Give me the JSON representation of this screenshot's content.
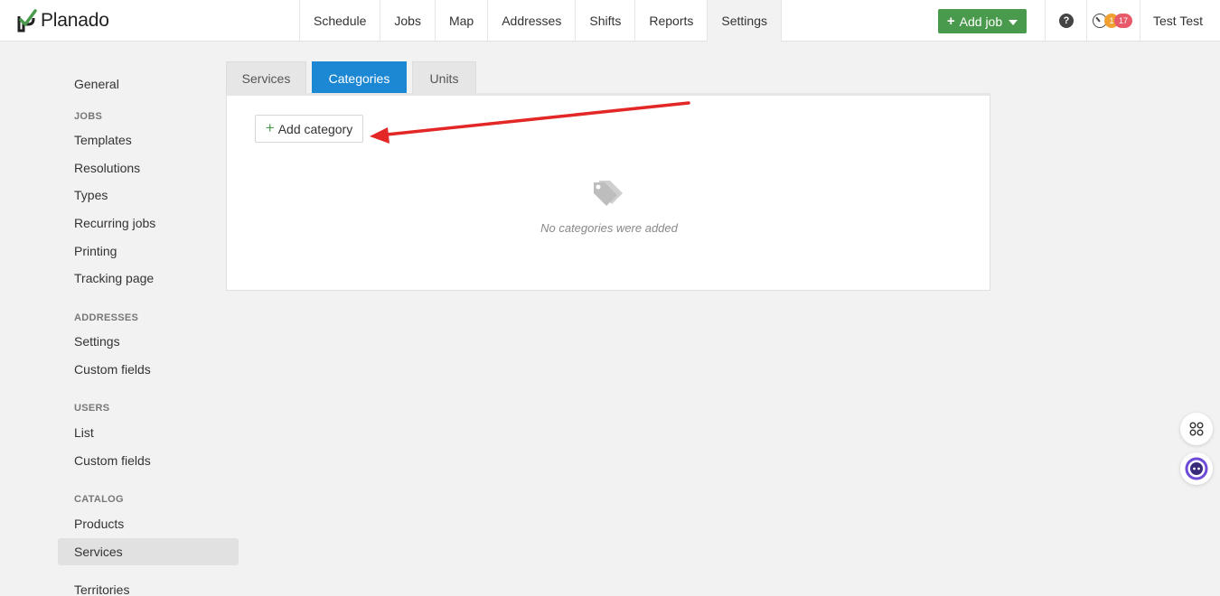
{
  "app": {
    "logo_text": "Planado",
    "brand_color": "#4a9a4d",
    "accent_color": "#1c88d4"
  },
  "navbar": {
    "items": [
      {
        "label": "Schedule"
      },
      {
        "label": "Jobs"
      },
      {
        "label": "Map"
      },
      {
        "label": "Addresses"
      },
      {
        "label": "Shifts"
      },
      {
        "label": "Reports"
      },
      {
        "label": "Settings",
        "active": true
      }
    ],
    "add_job_label": "Add job",
    "help_label": "?",
    "notif_count_1": "1",
    "notif_count_2": "17",
    "user_name": "Test Test"
  },
  "sidebar": {
    "general": "General",
    "jobs_heading": "JOBS",
    "jobs": [
      "Templates",
      "Resolutions",
      "Types",
      "Recurring jobs",
      "Printing",
      "Tracking page"
    ],
    "addresses_heading": "ADDRESSES",
    "addresses": [
      "Settings",
      "Custom fields"
    ],
    "users_heading": "USERS",
    "users": [
      "List",
      "Custom fields"
    ],
    "catalog_heading": "CATALOG",
    "catalog": [
      "Products",
      "Services"
    ],
    "territories": "Territories",
    "active_item": "Services"
  },
  "tabs": [
    {
      "label": "Services"
    },
    {
      "label": "Categories",
      "active": true
    },
    {
      "label": "Units"
    }
  ],
  "panel": {
    "add_category_label": "Add category",
    "empty_message": "No categories were added"
  },
  "icons": {
    "logo": "planado-check-icon",
    "empty": "tags-icon",
    "help": "help-circle-icon",
    "notifications": "clock-icon",
    "widget_1": "grid-icon",
    "widget_2": "chat-bot-icon"
  }
}
